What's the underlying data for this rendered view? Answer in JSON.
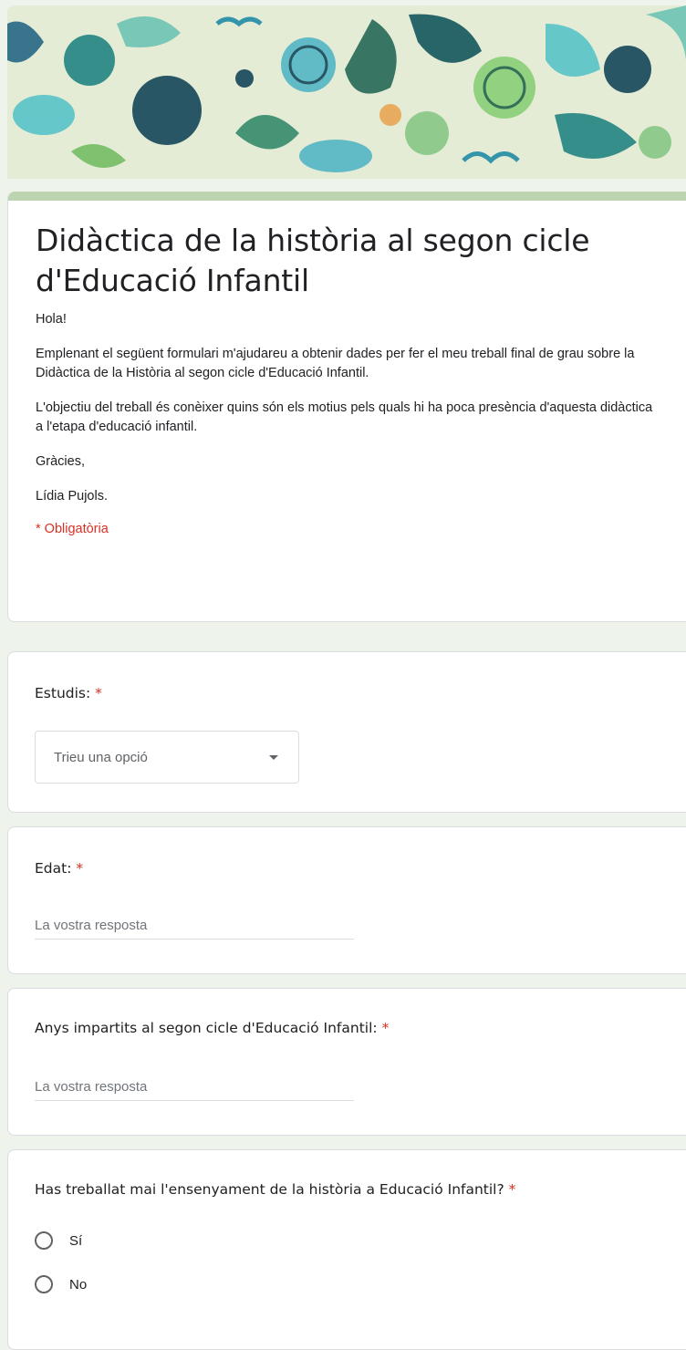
{
  "form": {
    "title": "Didàctica de la història al segon cicle d'Educació Infantil",
    "description": [
      "Hola!",
      "Emplenant el següent formulari m'ajudareu a obtenir dades per fer el meu treball final de grau sobre la Didàctica de la Història al segon cicle d'Educació Infantil.",
      "L'objectiu del treball és conèixer quins són els motius pels quals hi ha poca presència d'aquesta didàctica a l'etapa d'educació infantil.",
      "Gràcies,",
      "Lídia Pujols."
    ],
    "required_note": "* Obligatòria",
    "accent_color": "#bcd4b0",
    "required_color": "#d93025"
  },
  "questions": {
    "studies": {
      "title": "Estudis:",
      "required_mark": "*",
      "select_value": "Trieu una opció"
    },
    "age": {
      "title": "Edat:",
      "required_mark": "*",
      "placeholder": "La vostra resposta"
    },
    "years": {
      "title": "Anys impartits al segon cicle d'Educació Infantil:",
      "required_mark": "*",
      "placeholder": "La vostra resposta"
    },
    "worked": {
      "title": "Has treballat mai l'ensenyament de la història a Educació Infantil?",
      "required_mark": "*",
      "options": [
        "Sí",
        "No"
      ]
    }
  }
}
